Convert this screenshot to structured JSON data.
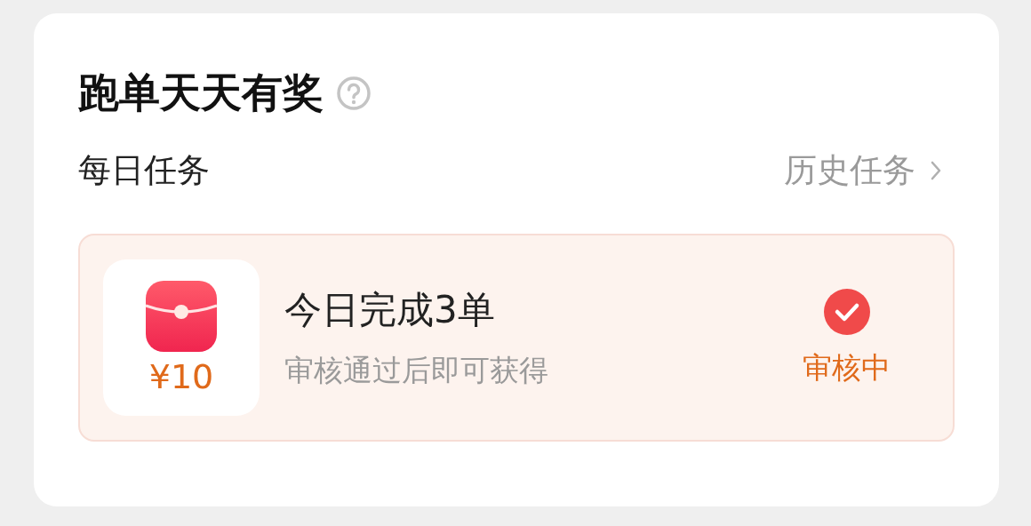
{
  "card": {
    "title": "跑单天天有奖",
    "section_label": "每日任务",
    "history_link": "历史任务"
  },
  "tasks": [
    {
      "reward": "¥10",
      "title": "今日完成3单",
      "subtitle": "审核通过后即可获得",
      "status": {
        "kind": "reviewing",
        "label": "审核中"
      }
    }
  ]
}
